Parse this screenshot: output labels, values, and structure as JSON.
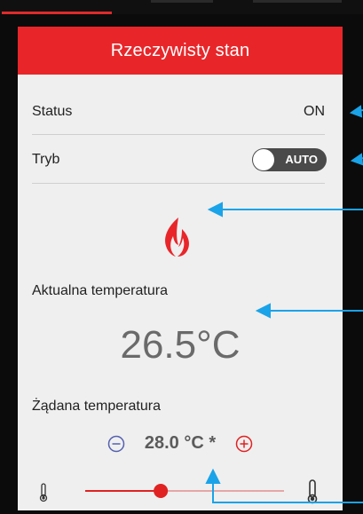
{
  "card": {
    "title": "Rzeczywisty stan"
  },
  "status": {
    "label": "Status",
    "value": "ON"
  },
  "mode": {
    "label": "Tryb",
    "toggle_label": "AUTO"
  },
  "current_temp": {
    "label": "Aktualna temperatura",
    "value": "26.5°C"
  },
  "target_temp": {
    "label": "Żądana temperatura",
    "value": "28.0 °C *",
    "slider_fraction": 0.38
  },
  "icons": {
    "decrease": "minus-circle-icon",
    "increase": "plus-circle-icon",
    "heating": "flame-icon",
    "thermometer_low": "thermometer-low-icon",
    "thermometer_high": "thermometer-high-icon"
  },
  "colors": {
    "header": "#e8262a",
    "accent_blue": "#1aa3e8",
    "slider_active": "#e02222",
    "slider_inactive": "#e6a6a6",
    "decrease_icon": "#5560b0",
    "increase_icon": "#e02222"
  }
}
